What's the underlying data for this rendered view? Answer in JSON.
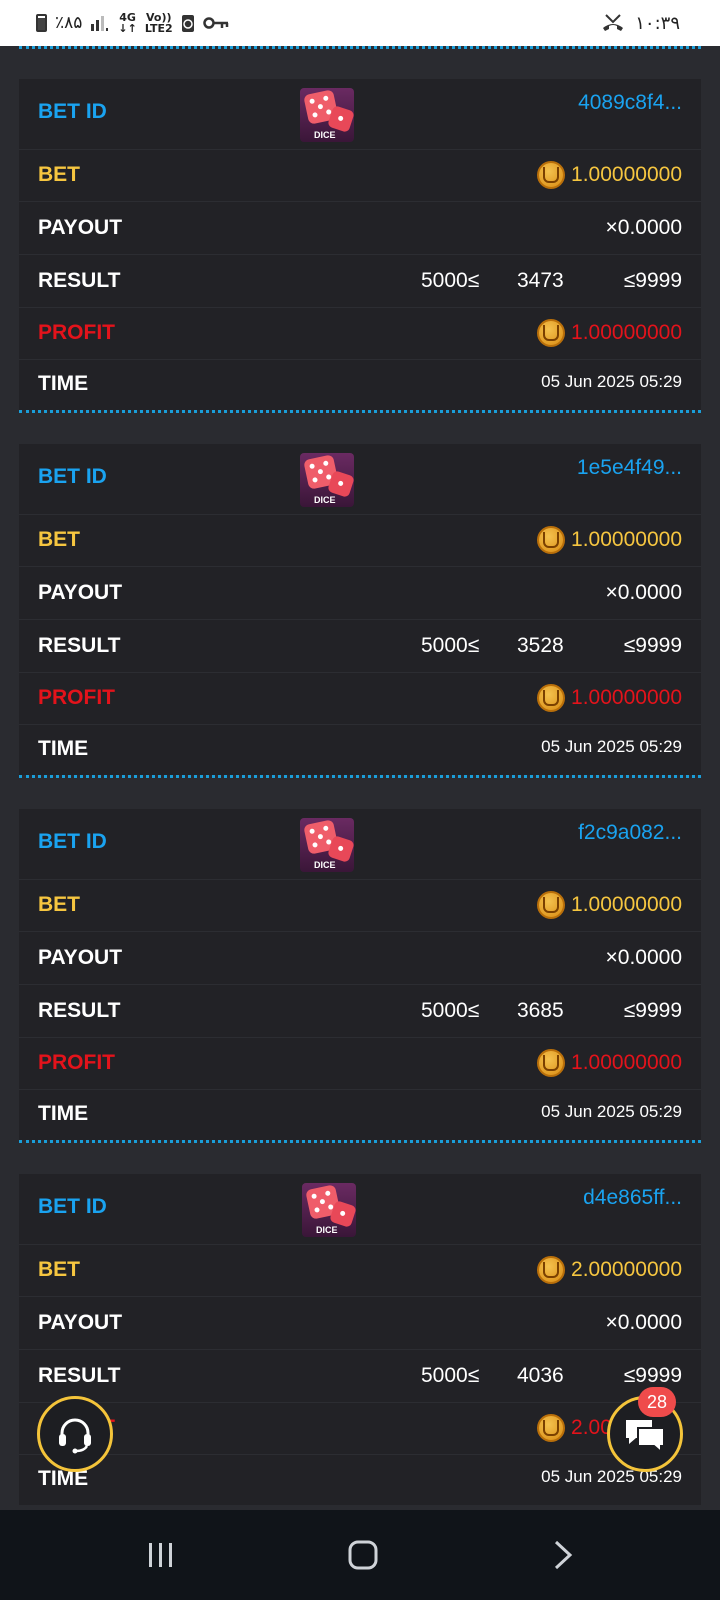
{
  "status_bar": {
    "battery": "٪۸۵",
    "network_4g": "4G",
    "volte": "Vo))",
    "lte": "LTE2",
    "time": "۱۰:۳۹"
  },
  "labels": {
    "bet_id": "BET ID",
    "bet": "BET",
    "payout": "PAYOUT",
    "result": "RESULT",
    "profit": "PROFIT",
    "time": "TIME",
    "dice": "DICE"
  },
  "bets": [
    {
      "bet_id": "4089c8f4...",
      "bet": "1.00000000",
      "payout": "×0.0000",
      "result_low": "5000≤",
      "result_value": "3473",
      "result_high": "≤9999",
      "profit": "1.00000000",
      "time": "05 Jun 2025 05:29"
    },
    {
      "bet_id": "1e5e4f49...",
      "bet": "1.00000000",
      "payout": "×0.0000",
      "result_low": "5000≤",
      "result_value": "3528",
      "result_high": "≤9999",
      "profit": "1.00000000",
      "time": "05 Jun 2025 05:29"
    },
    {
      "bet_id": "f2c9a082...",
      "bet": "1.00000000",
      "payout": "×0.0000",
      "result_low": "5000≤",
      "result_value": "3685",
      "result_high": "≤9999",
      "profit": "1.00000000",
      "time": "05 Jun 2025 05:29"
    },
    {
      "bet_id": "d4e865ff...",
      "bet": "2.00000000",
      "payout": "×0.0000",
      "result_low": "5000≤",
      "result_value": "4036",
      "result_high": "≤9999",
      "profit": "2.00000000",
      "time": "05 Jun 2025 05:29"
    }
  ],
  "chat": {
    "badge_count": "28"
  },
  "colors": {
    "label_blue": "#1aa3f0",
    "label_yellow": "#f6c640",
    "profit_red": "#e3131b",
    "accent_gold": "#f4c43a",
    "divider_dots": "#1a9ed9"
  },
  "icons": [
    "battery-icon",
    "signal-icon",
    "key-icon",
    "missed-call-icon",
    "dice-game-icon",
    "coin-icon",
    "support-headset-icon",
    "chat-icon",
    "recents-icon",
    "home-icon",
    "back-icon"
  ]
}
